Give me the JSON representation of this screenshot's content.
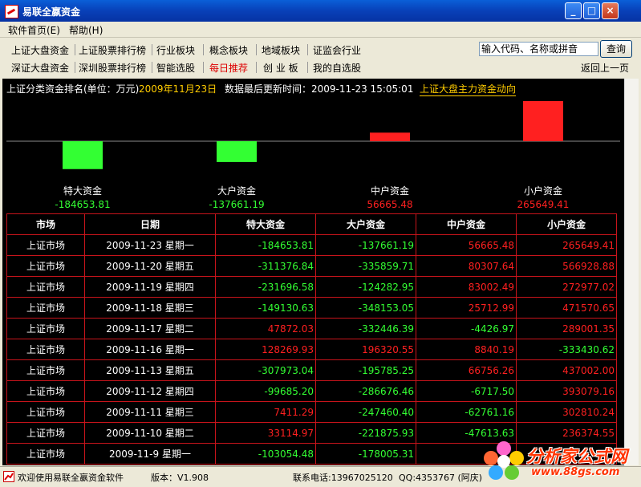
{
  "window": {
    "title": "易联全嬴资金"
  },
  "menu": {
    "items": [
      "软件首页(E)",
      "帮助(H)"
    ]
  },
  "nav": {
    "row1": [
      "上证大盘资金",
      "上证股票排行榜",
      "行业板块",
      "概念板块",
      "地域板块",
      "证监会行业"
    ],
    "row2": [
      "深证大盘资金",
      "深圳股票排行榜",
      "智能选股",
      "每日推荐",
      "创 业 板",
      "我的自选股"
    ],
    "back": "返回上一页"
  },
  "search": {
    "value": "输入代码、名称或拼音",
    "button": "查询"
  },
  "info": {
    "ranking_label": "上证分类资金排名(单位：万元)",
    "ranking_date": "2009年11月23日",
    "update_text": "数据最后更新时间：2009-11-23 15:05:01",
    "trend_link": "上证大盘主力资金动向"
  },
  "chart_data": {
    "type": "bar",
    "categories": [
      "特大资金",
      "大户资金",
      "中户资金",
      "小户资金"
    ],
    "values": [
      -184653.81,
      -137661.19,
      56665.48,
      265649.41
    ],
    "value_labels": [
      "-184653.81",
      "-137661.19",
      "56665.48",
      "265649.41"
    ]
  },
  "colors": {
    "positive": "#ff2020",
    "negative": "#33ff33",
    "date_yellow": "#ffcc00"
  },
  "table": {
    "headers": [
      "市场",
      "日期",
      "特大资金",
      "大户资金",
      "中户资金",
      "小户资金"
    ],
    "rows": [
      [
        "上证市场",
        "2009-11-23 星期一",
        "-184653.81",
        "-137661.19",
        "56665.48",
        "265649.41"
      ],
      [
        "上证市场",
        "2009-11-20 星期五",
        "-311376.84",
        "-335859.71",
        "80307.64",
        "566928.88"
      ],
      [
        "上证市场",
        "2009-11-19 星期四",
        "-231696.58",
        "-124282.95",
        "83002.49",
        "272977.02"
      ],
      [
        "上证市场",
        "2009-11-18 星期三",
        "-149130.63",
        "-348153.05",
        "25712.99",
        "471570.65"
      ],
      [
        "上证市场",
        "2009-11-17 星期二",
        "47872.03",
        "-332446.39",
        "-4426.97",
        "289001.35"
      ],
      [
        "上证市场",
        "2009-11-16 星期一",
        "128269.93",
        "196320.55",
        "8840.19",
        "-333430.62"
      ],
      [
        "上证市场",
        "2009-11-13 星期五",
        "-307973.04",
        "-195785.25",
        "66756.26",
        "437002.00"
      ],
      [
        "上证市场",
        "2009-11-12 星期四",
        "-99685.20",
        "-286676.46",
        "-6717.50",
        "393079.16"
      ],
      [
        "上证市场",
        "2009-11-11 星期三",
        "7411.29",
        "-247460.40",
        "-62761.16",
        "302810.24"
      ],
      [
        "上证市场",
        "2009-11-10 星期二",
        "33114.97",
        "-221875.93",
        "-47613.63",
        "236374.55"
      ],
      [
        "上证市场",
        "2009-11-9 星期一",
        "-103054.48",
        "-178005.31",
        "",
        ""
      ]
    ]
  },
  "status": {
    "welcome": "欢迎使用易联全嬴资金软件",
    "version": "版本：V1.908",
    "phone": "联系电话:13967025120",
    "qq": "QQ:4353767 (阿庆)"
  },
  "watermark": {
    "line1": "分析家公式网",
    "line2": "www.88gs.com"
  }
}
